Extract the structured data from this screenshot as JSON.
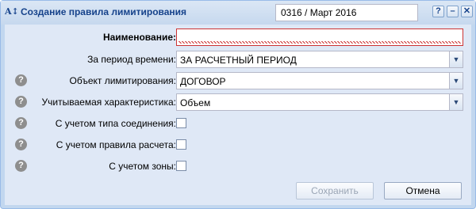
{
  "window": {
    "title": "Создание правила лимитирования",
    "app_icon": "A↕",
    "period": "0316 / Март 2016",
    "tools": {
      "help": "?",
      "minimize": "–",
      "close": "✕"
    }
  },
  "form": {
    "name": {
      "label": "Наименование:",
      "value": ""
    },
    "period": {
      "label": "За период времени:",
      "value": "ЗА РАСЧЕТНЫЙ ПЕРИОД"
    },
    "object": {
      "label": "Объект лимитирования:",
      "value": "ДОГОВОР"
    },
    "characteristic": {
      "label": "Учитываемая характеристика:",
      "value": "Объем"
    },
    "connection_type": {
      "label": "С учетом типа соединения:",
      "checked": false
    },
    "calc_rule": {
      "label": "С учетом правила расчета:",
      "checked": false
    },
    "zone": {
      "label": "С учетом зоны:",
      "checked": false
    },
    "help_glyph": "?",
    "combo_arrow": "▼"
  },
  "buttons": {
    "save": {
      "label": "Сохранить",
      "enabled": false
    },
    "cancel": {
      "label": "Отмена",
      "enabled": true
    }
  },
  "colors": {
    "title_text": "#15428b",
    "panel_bg": "#dfe8f6",
    "invalid": "#cc3333"
  }
}
